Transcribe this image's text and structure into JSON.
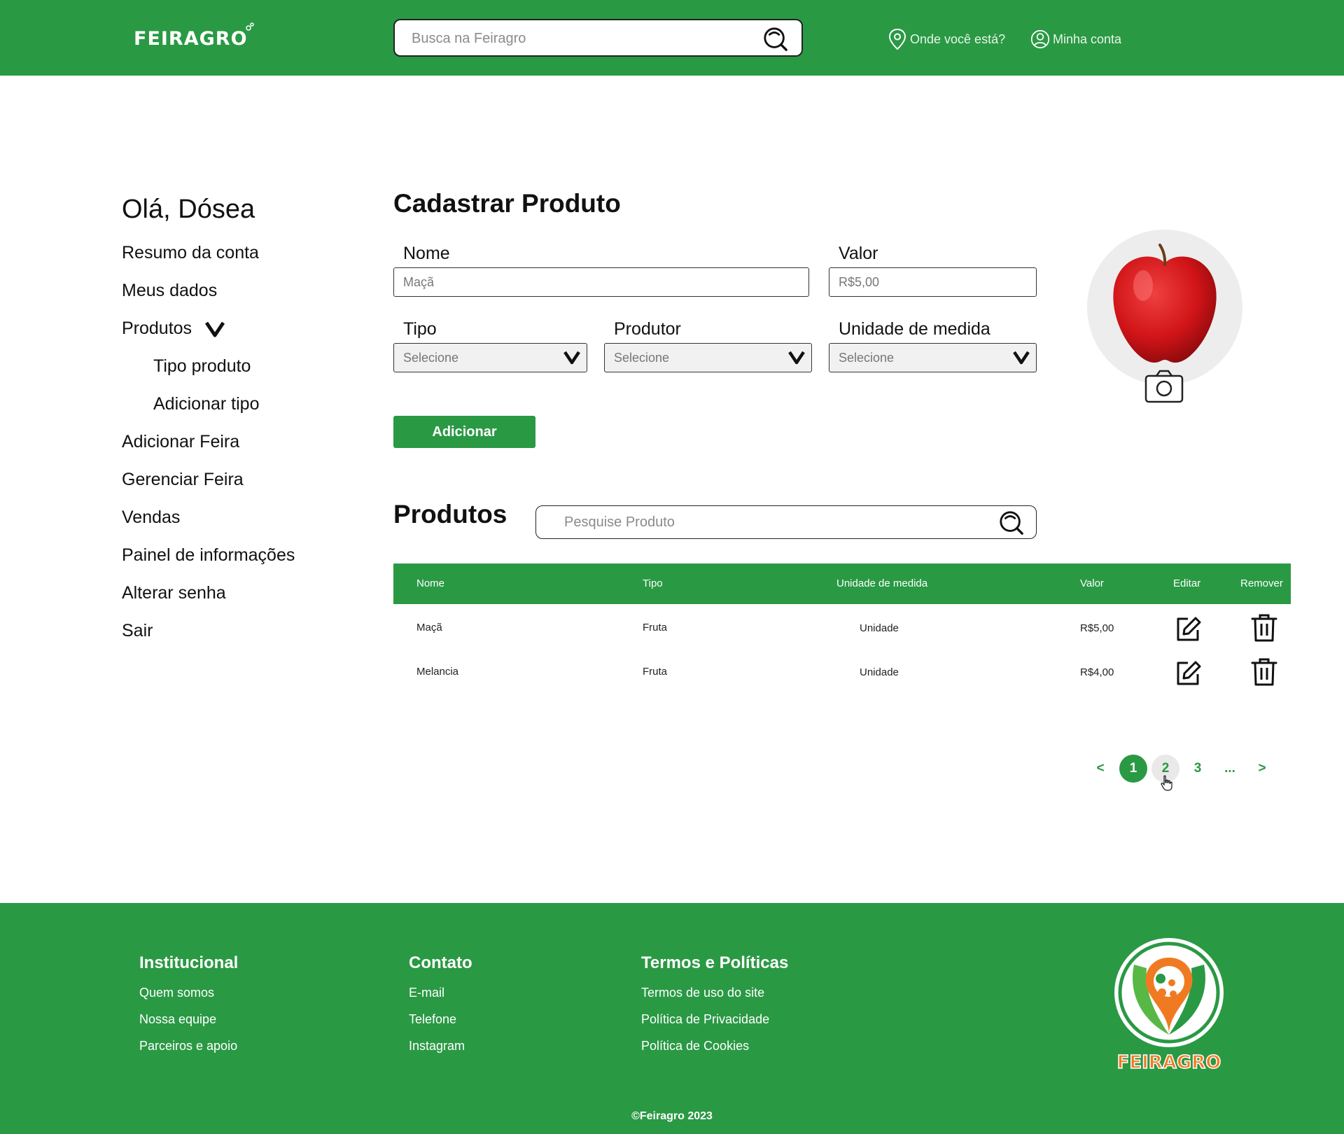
{
  "header": {
    "logo_text": "FEIRAGRO",
    "search_placeholder": "Busca na Feiragro",
    "location_label": "Onde você está?",
    "account_label": "Minha conta"
  },
  "sidebar": {
    "greeting": "Olá, Dósea",
    "items": [
      {
        "label": "Resumo da conta"
      },
      {
        "label": "Meus dados"
      },
      {
        "label": "Produtos"
      },
      {
        "label": "Tipo produto"
      },
      {
        "label": "Adicionar tipo"
      },
      {
        "label": "Adicionar Feira"
      },
      {
        "label": "Gerenciar Feira"
      },
      {
        "label": "Vendas"
      },
      {
        "label": "Painel de informações"
      },
      {
        "label": "Alterar senha"
      },
      {
        "label": "Sair"
      }
    ]
  },
  "form": {
    "title": "Cadastrar Produto",
    "name_label": "Nome",
    "name_value": "Maçã",
    "value_label": "Valor",
    "value_value": "R$5,00",
    "type_label": "Tipo",
    "type_value": "Selecione",
    "producer_label": "Produtor",
    "producer_value": "Selecione",
    "unit_label": "Unidade de medida",
    "unit_value": "Selecione",
    "submit_label": "Adicionar"
  },
  "products": {
    "title": "Produtos",
    "search_placeholder": "Pesquise Produto",
    "columns": [
      "Nome",
      "Tipo",
      "Unidade de medida",
      "Valor",
      "Editar",
      "Remover"
    ],
    "rows": [
      {
        "nome": "Maçã",
        "tipo": "Fruta",
        "unidade": "Unidade",
        "valor": "R$5,00"
      },
      {
        "nome": "Melancia",
        "tipo": "Fruta",
        "unidade": "Unidade",
        "valor": "R$4,00"
      }
    ]
  },
  "pagination": {
    "prev": "<",
    "pages": [
      "1",
      "2",
      "3"
    ],
    "ellipsis": "...",
    "next": ">",
    "current": "1"
  },
  "footer": {
    "columns": [
      {
        "title": "Institucional",
        "links": [
          "Quem somos",
          "Nossa equipe",
          "Parceiros e apoio"
        ]
      },
      {
        "title": "Contato",
        "links": [
          "E-mail",
          "Telefone",
          "Instagram"
        ]
      },
      {
        "title": "Termos e Políticas",
        "links": [
          "Termos de uso do site",
          "Política de Privacidade",
          "Política de Cookies"
        ]
      }
    ],
    "logo_text": "FEIRAGRO",
    "copyright": "©Feiragro 2023"
  },
  "colors": {
    "brand_green": "#2a9944",
    "logo_orange": "#f07a22"
  }
}
